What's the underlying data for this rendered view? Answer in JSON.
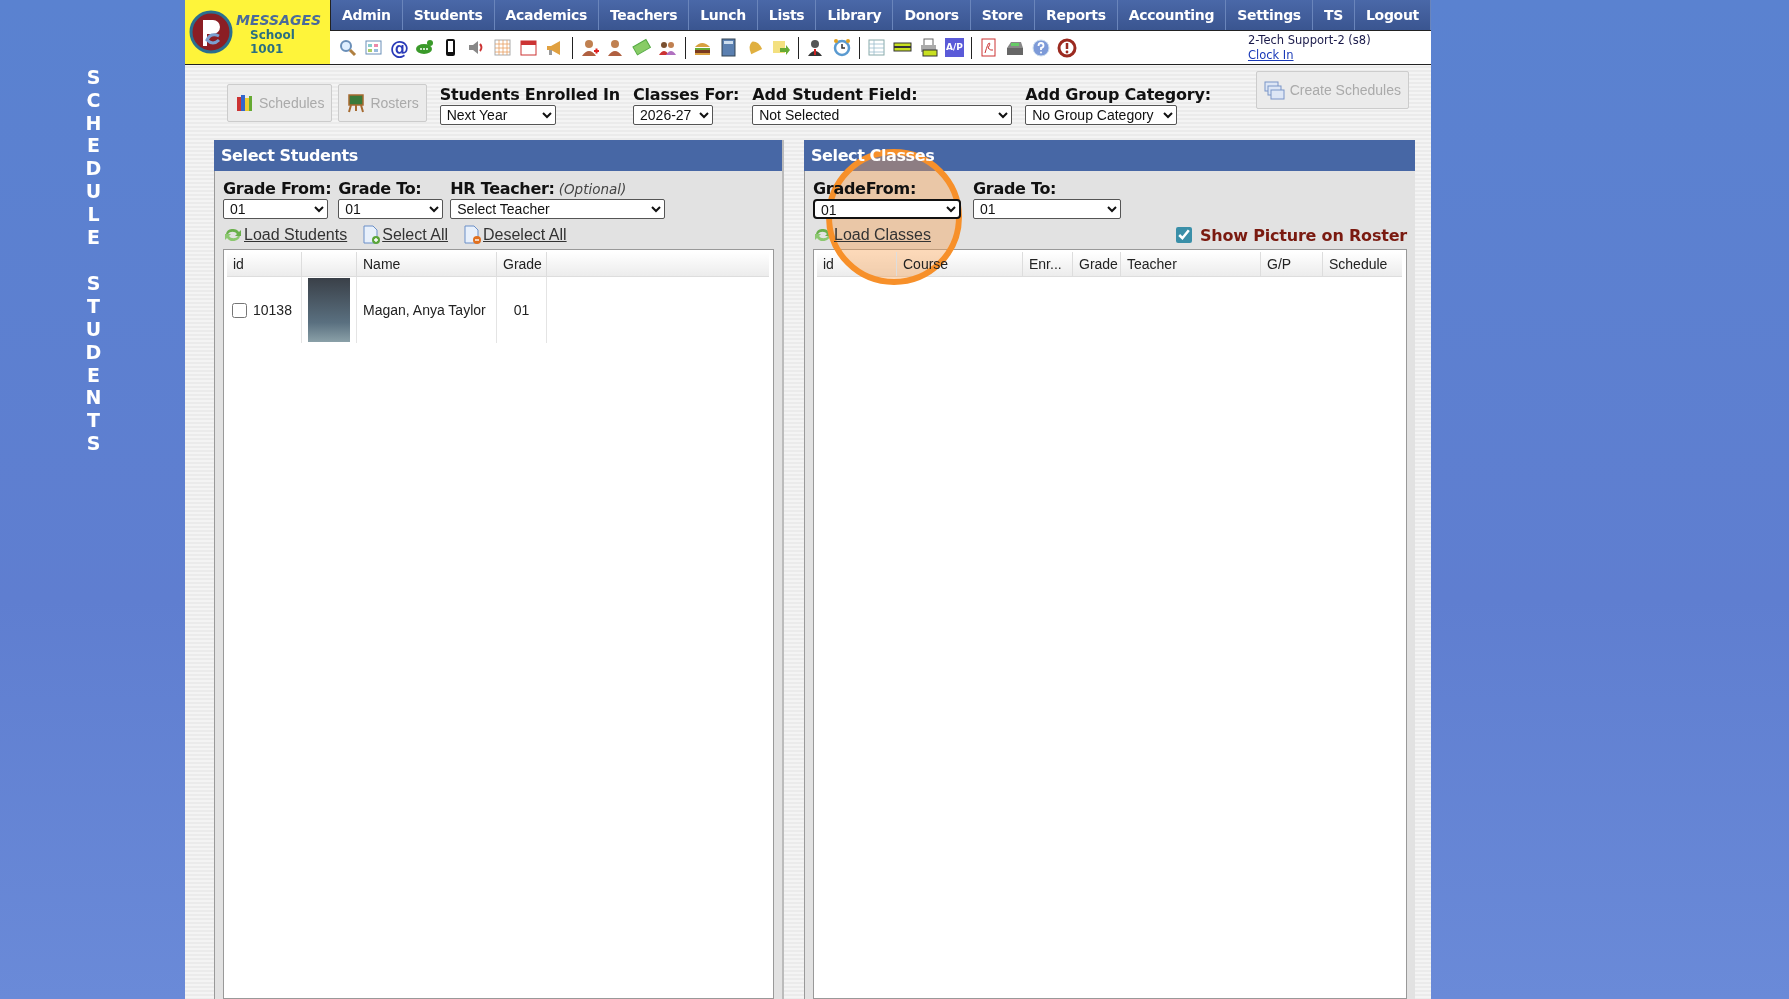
{
  "side_title": [
    "SCHEDULE",
    "STUDENTS"
  ],
  "logo": {
    "brand": "MESSAGES",
    "school": "School 1001"
  },
  "nav": [
    "Admin",
    "Students",
    "Academics",
    "Teachers",
    "Lunch",
    "Lists",
    "Library",
    "Donors",
    "Store",
    "Reports",
    "Accounting",
    "Settings",
    "TS",
    "Logout"
  ],
  "toolbar": {
    "at_label": "@",
    "ap_label": "A/P"
  },
  "user": {
    "name": "2-Tech Support-2 (s8)",
    "link": "Clock In"
  },
  "top_buttons": [
    {
      "label": "Schedules",
      "disabled": true
    },
    {
      "label": "Rosters",
      "disabled": true
    }
  ],
  "filters": [
    {
      "label": "Students Enrolled In",
      "value": "Next Year"
    },
    {
      "label": "Classes For:",
      "value": "2026-27"
    },
    {
      "label": "Add Student Field:",
      "value": "Not Selected"
    },
    {
      "label": "Add Group Category:",
      "value": "No Group Category"
    }
  ],
  "create_button": {
    "label": "Create Schedules",
    "disabled": true
  },
  "students_panel": {
    "title": "Select Students",
    "grade_from": {
      "label": "Grade From:",
      "value": "01"
    },
    "grade_to": {
      "label": "Grade To:",
      "value": "01"
    },
    "teacher": {
      "label": "HR Teacher:",
      "hint": "(Optional)",
      "value": "Select Teacher"
    },
    "links": [
      "Load Students",
      "Select All",
      "Deselect All"
    ],
    "columns": [
      "id",
      "",
      "Name",
      "Grade"
    ],
    "rows": [
      {
        "id": "10138",
        "name": "Magan, Anya Taylor",
        "grade": "01",
        "selected": false
      }
    ]
  },
  "classes_panel": {
    "title": "Select Classes",
    "grade_from": {
      "label": "GradeFrom:",
      "value": "01"
    },
    "grade_to": {
      "label": "Grade To:",
      "value": "01"
    },
    "load_link": "Load Classes",
    "show_picture": {
      "label": "Show Picture on Roster",
      "checked": true
    },
    "columns": [
      "id",
      "Course",
      "Enr...",
      "Grade",
      "Teacher",
      "G/P",
      "Schedule"
    ]
  }
}
